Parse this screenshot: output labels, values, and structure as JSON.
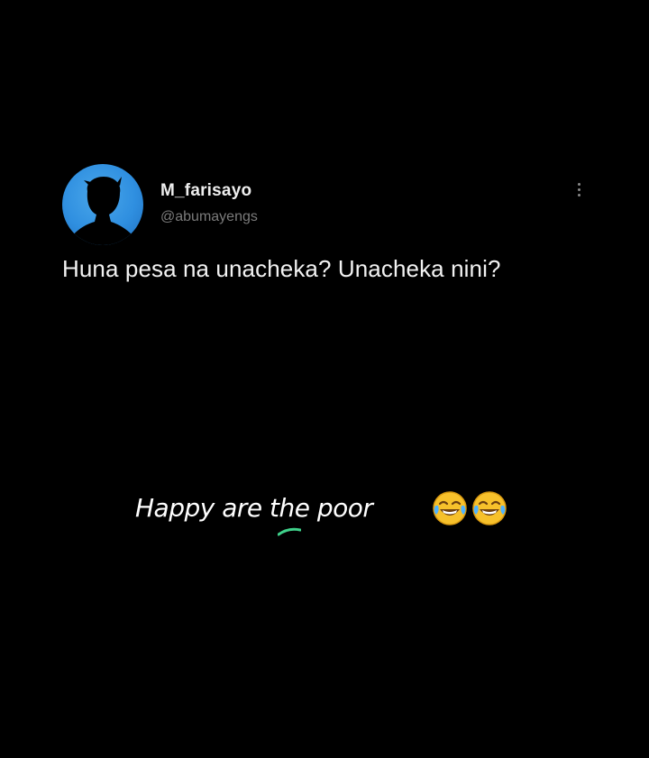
{
  "tweet": {
    "display_name": "M_farisayo",
    "handle": "@abumayengs",
    "text": "Huna pesa na unacheka? Unacheka nini?",
    "avatar_icon": "silhouette-avatar-icon",
    "more_icon": "more-vertical-icon"
  },
  "caption": {
    "text": "Happy are the poor",
    "emoji_icon": "face-with-tears-of-joy-icon",
    "emoji_count": 2
  },
  "colors": {
    "background": "#000000",
    "avatar_blue": "#2f8fe0",
    "handle_gray": "#7b7b7b",
    "emoji_yellow": "#f7c12b",
    "tear_blue": "#4fb3ff",
    "swoosh_green": "#3fd08a"
  }
}
